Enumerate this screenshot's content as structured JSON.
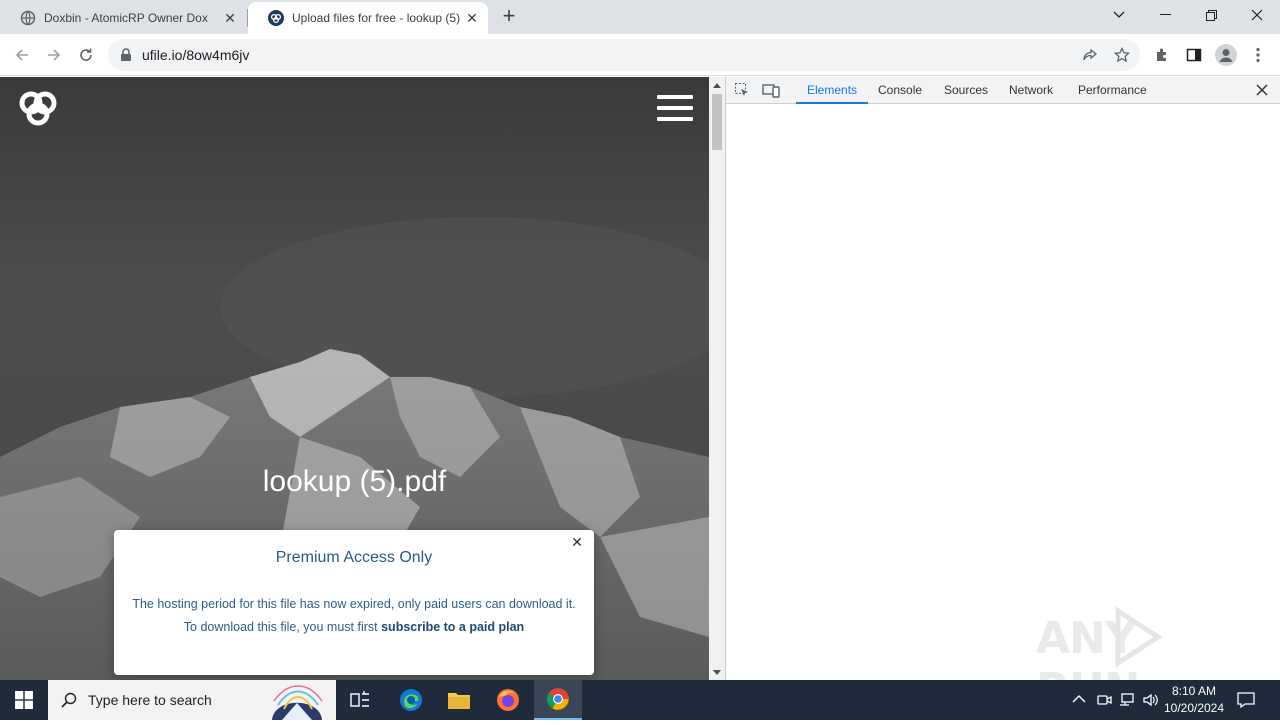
{
  "browser": {
    "tabs": [
      {
        "title": "Doxbin - AtomicRP Owner Dox",
        "favicon": "globe-icon"
      },
      {
        "title": "Upload files for free - lookup (5)",
        "favicon": "ufile-logo-icon"
      }
    ],
    "address": "ufile.io/8ow4m6jv"
  },
  "page": {
    "file_name": "lookup (5).pdf",
    "modal": {
      "title": "Premium Access Only",
      "message": "The hosting period for this file has now expired, only paid users can download it.",
      "cta_prefix": "To download this file, you must first ",
      "cta_link": "subscribe to a paid plan"
    }
  },
  "devtools": {
    "tabs": [
      "Elements",
      "Console",
      "Sources",
      "Network",
      "Performance"
    ],
    "active_tab": "Elements"
  },
  "watermark": {
    "text": "ANY RUN"
  },
  "taskbar": {
    "search_placeholder": "Type here to search",
    "time": "8:10 AM",
    "date": "10/20/2024"
  },
  "colors": {
    "accent": "#1a73e8",
    "taskbar": "#1f2a3a",
    "modal_text": "#2f5d8a"
  }
}
